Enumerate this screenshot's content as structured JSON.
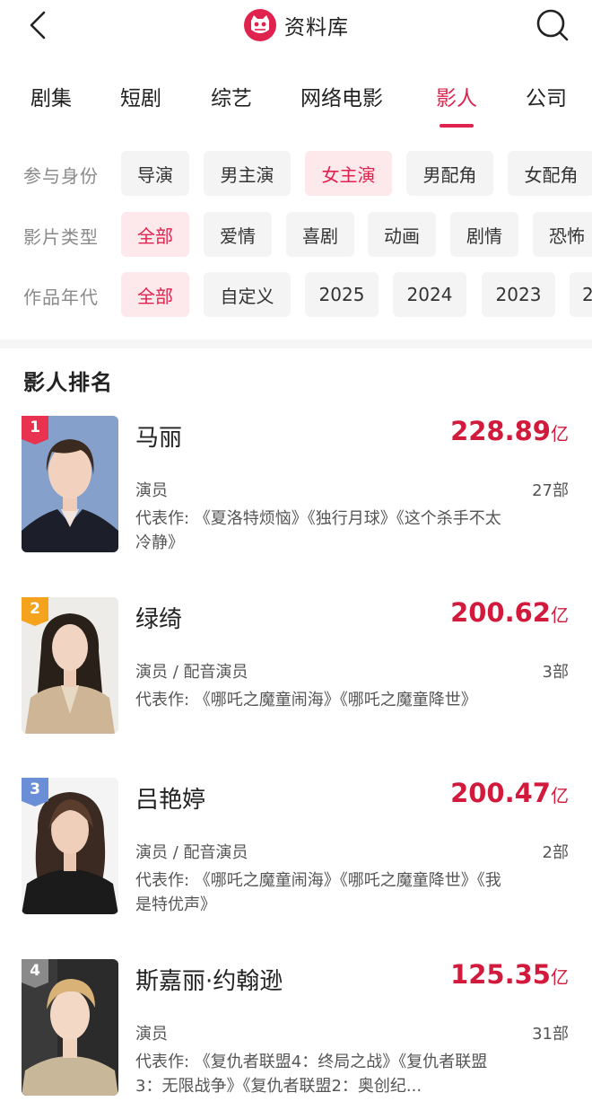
{
  "header": {
    "title": "资料库"
  },
  "tabs": [
    {
      "label": "剧集",
      "active": false
    },
    {
      "label": "短剧",
      "active": false
    },
    {
      "label": "综艺",
      "active": false
    },
    {
      "label": "网络电影",
      "active": false
    },
    {
      "label": "影人",
      "active": true
    },
    {
      "label": "公司",
      "active": false
    }
  ],
  "filters": {
    "identity": {
      "label": "参与身份",
      "options": [
        "导演",
        "男主演",
        "女主演",
        "男配角",
        "女配角"
      ],
      "selected": "女主演"
    },
    "genre": {
      "label": "影片类型",
      "options": [
        "全部",
        "爱情",
        "喜剧",
        "动画",
        "剧情",
        "恐怖"
      ],
      "selected": "全部"
    },
    "year": {
      "label": "作品年代",
      "options": [
        "全部",
        "自定义",
        "2025",
        "2024",
        "2023",
        "2"
      ],
      "selected": "全部"
    }
  },
  "ranking": {
    "title": "影人排名",
    "items": [
      {
        "rank": "1",
        "name": "马丽",
        "box_office": "228.89",
        "unit": "亿",
        "role": "演员",
        "count": "27部",
        "works": "代表作: 《夏洛特烦恼》《独行月球》《这个杀手不太冷静》",
        "badge_color": "#e8324f"
      },
      {
        "rank": "2",
        "name": "绿绮",
        "box_office": "200.62",
        "unit": "亿",
        "role": "演员 / 配音演员",
        "count": "3部",
        "works": "代表作: 《哪吒之魔童闹海》《哪吒之魔童降世》",
        "badge_color": "#f5a21c"
      },
      {
        "rank": "3",
        "name": "吕艳婷",
        "box_office": "200.47",
        "unit": "亿",
        "role": "演员 / 配音演员",
        "count": "2部",
        "works": "代表作: 《哪吒之魔童闹海》《哪吒之魔童降世》《我是特优声》",
        "badge_color": "#6b8fd6"
      },
      {
        "rank": "4",
        "name": "斯嘉丽·约翰逊",
        "box_office": "125.35",
        "unit": "亿",
        "role": "演员",
        "count": "31部",
        "works": "代表作: 《复仇者联盟4：终局之战》《复仇者联盟3：无限战争》《复仇者联盟2：奥创纪...",
        "badge_color": "#8a8a8a"
      }
    ]
  },
  "colors": {
    "accent": "#e0234e",
    "box_office": "#d11a3c",
    "chip_bg": "#f4f4f4",
    "chip_active_bg": "#fde8ec"
  }
}
